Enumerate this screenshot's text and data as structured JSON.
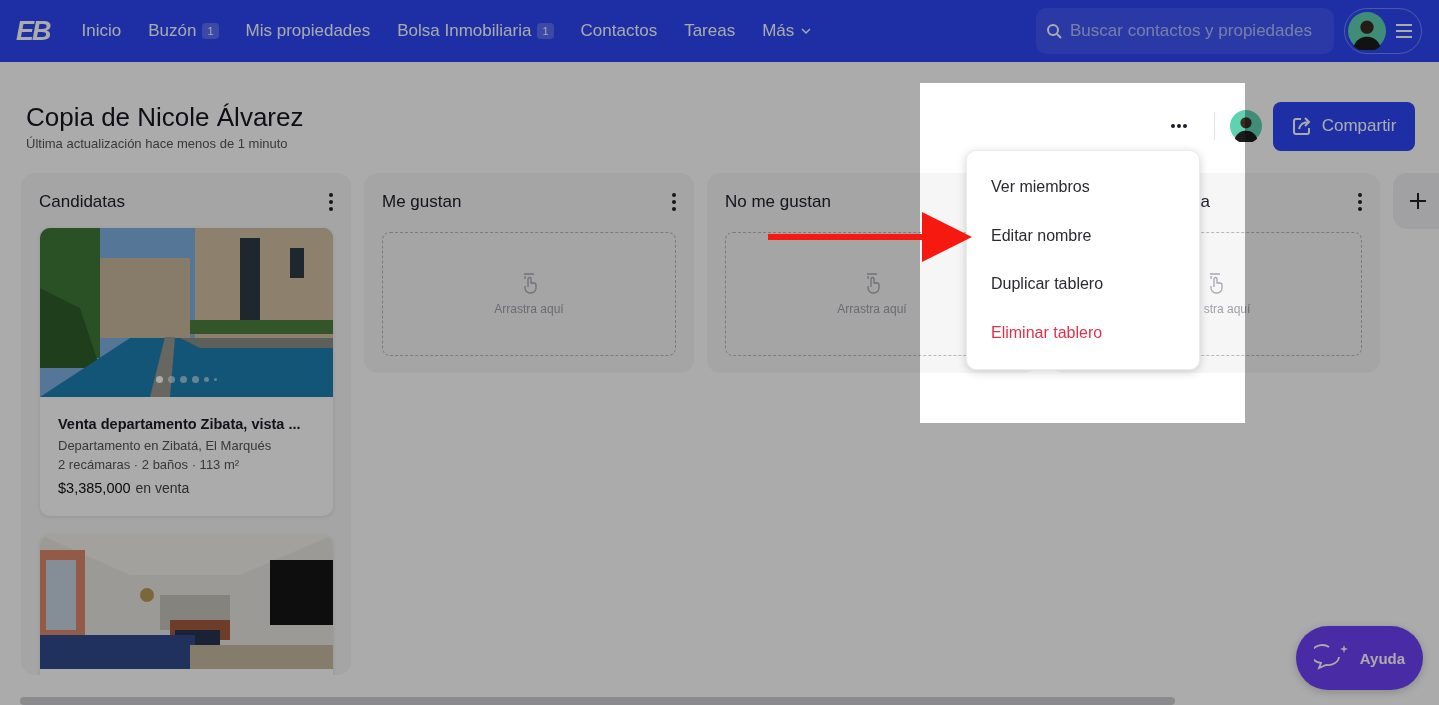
{
  "nav": {
    "logo": "EB",
    "items": [
      {
        "label": "Inicio",
        "dropdown": false
      },
      {
        "label": "Buzón",
        "badge": "1",
        "dropdown": false
      },
      {
        "label": "Mis propiedades",
        "dropdown": false
      },
      {
        "label": "Bolsa Inmobiliaria",
        "badge": "1",
        "dropdown": false
      },
      {
        "label": "Contactos",
        "dropdown": false
      },
      {
        "label": "Tareas",
        "dropdown": false
      },
      {
        "label": "Más",
        "dropdown": true
      }
    ],
    "search": {
      "placeholder": "Buscar contactos y propiedades"
    }
  },
  "board": {
    "title": "Copia de Nicole Álvarez",
    "updated": "Última actualización hace menos de 1 minuto",
    "share_button": "Compartir"
  },
  "columns": [
    {
      "title": "Candidatas",
      "cards": [
        {
          "kind": "listing",
          "title": "Venta departamento Zibata, vista ...",
          "subtitle": "Departamento en Zibatá, El Marqués",
          "specs": "2 recámaras · 2 baños · 113 m²",
          "price": "$3,385,000",
          "price_note": "en venta",
          "dots": [
            {
              "selected": true
            },
            {
              "selected": false
            },
            {
              "selected": false
            },
            {
              "selected": false
            },
            {
              "selected": false
            },
            {
              "selected": false
            }
          ]
        },
        {
          "kind": "picture"
        }
      ]
    },
    {
      "title": "Me gustan",
      "drop_hint": "Arrastra aquí"
    },
    {
      "title": "No me gustan",
      "drop_hint": "Arrastra aquí"
    },
    {
      "title": "a",
      "drop_hint": "stra aquí"
    }
  ],
  "menu": {
    "items": [
      {
        "label": "Ver miembros",
        "kind": "normal"
      },
      {
        "label": "Editar nombre",
        "kind": "normal"
      },
      {
        "label": "Duplicar tablero",
        "kind": "normal"
      },
      {
        "label": "Eliminar tablero",
        "kind": "danger"
      }
    ]
  },
  "help_button": "Ayuda"
}
